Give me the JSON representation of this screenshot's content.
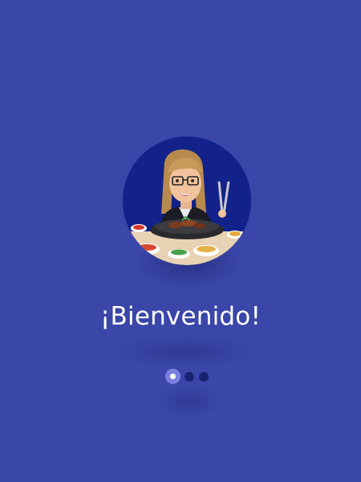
{
  "screen": {
    "background_color": "#3a46a8",
    "welcome_title": "¡Bienvenido!"
  },
  "avatar": {
    "icon": "bitmoji-bbq-avatar",
    "circle_color": "#12228a"
  },
  "pager": {
    "total_pages": 3,
    "active_page": 1,
    "active_color": "#7b7fe0",
    "inactive_color": "#1a2370"
  }
}
